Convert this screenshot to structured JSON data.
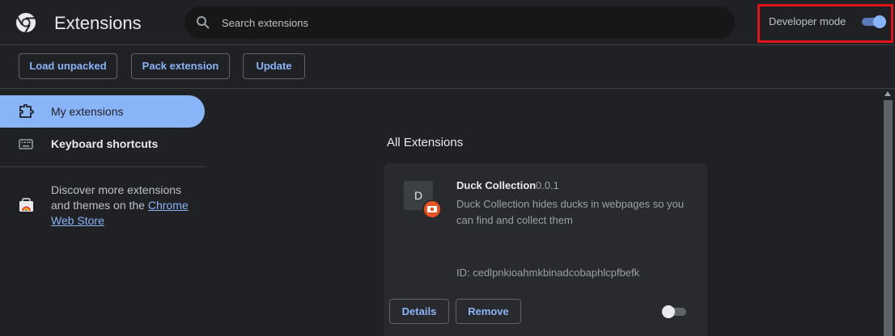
{
  "header": {
    "title": "Extensions",
    "logo_icon": "chrome-logo-icon",
    "search": {
      "placeholder": "Search extensions",
      "value": "",
      "icon": "search-icon"
    },
    "developer_mode": {
      "label": "Developer mode",
      "enabled": true
    },
    "highlight_color": "#e2141a"
  },
  "toolbar": {
    "load_unpacked": "Load unpacked",
    "pack_extension": "Pack extension",
    "update": "Update"
  },
  "sidebar": {
    "items": [
      {
        "label": "My extensions",
        "icon": "puzzle-icon",
        "active": true
      },
      {
        "label": "Keyboard shortcuts",
        "icon": "keyboard-icon",
        "active": false
      }
    ],
    "discover": {
      "text": "Discover more extensions and themes on the ",
      "link": "Chrome Web Store",
      "icon": "web-store-icon"
    }
  },
  "main": {
    "section_title": "All Extensions",
    "extensions": [
      {
        "icon_letter": "D",
        "badge_icon": "camera-badge-icon",
        "name": "Duck Collection",
        "version": "0.0.1",
        "description": "Duck Collection hides ducks in webpages so you can find and collect them",
        "id": "ID: cedlpnkioahmkbinadcobaphlcpfbefk",
        "details_label": "Details",
        "remove_label": "Remove",
        "enabled": false
      }
    ]
  },
  "colors": {
    "background": "#202124",
    "card": "#292a2d",
    "accent": "#8ab4f8",
    "text": "#e8eaed",
    "muted": "#9aa0a6"
  }
}
